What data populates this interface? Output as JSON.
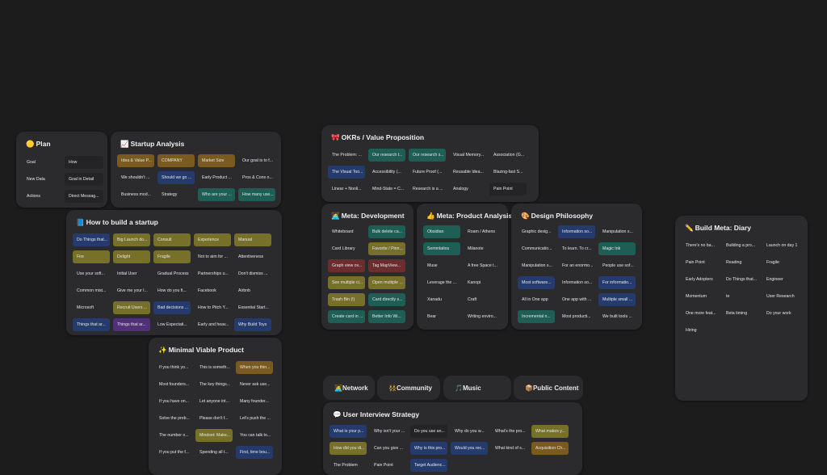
{
  "boards": {
    "plan": {
      "emoji": "🟡",
      "title": "Plan",
      "cards": [
        {
          "text": "Goal",
          "color": "plain"
        },
        {
          "text": "How",
          "color": "dark"
        },
        {
          "text": "New Data",
          "color": "plain"
        },
        {
          "text": "Goal in Detail",
          "color": "dark"
        },
        {
          "text": "Actions",
          "color": "plain"
        },
        {
          "text": "Direct Messag...",
          "color": "dark"
        }
      ]
    },
    "startup_analysis": {
      "emoji": "📈",
      "title": "Startup Analysis",
      "cards": [
        {
          "text": "Idea & Value P...",
          "color": "brown"
        },
        {
          "text": "COMPANY",
          "color": "brown"
        },
        {
          "text": "Market Size",
          "color": "brown"
        },
        {
          "text": "Our goal is to f...",
          "color": "plain"
        },
        {
          "text": "We shouldn't ...",
          "color": "plain"
        },
        {
          "text": "Should we go ...",
          "color": "blue"
        },
        {
          "text": "Early Product ...",
          "color": "plain"
        },
        {
          "text": "Pros & Cons o...",
          "color": "plain"
        },
        {
          "text": "Business mod...",
          "color": "plain"
        },
        {
          "text": "Strategy",
          "color": "plain"
        },
        {
          "text": "Who are your ...",
          "color": "teal"
        },
        {
          "text": "How many use...",
          "color": "teal"
        }
      ]
    },
    "build_startup": {
      "emoji": "📘",
      "title": "How to build a startup",
      "cards": [
        {
          "text": "Do Things that...",
          "color": "blue"
        },
        {
          "text": "Big Launch do...",
          "color": "olive"
        },
        {
          "text": "Consult",
          "color": "olive"
        },
        {
          "text": "Experience",
          "color": "olive"
        },
        {
          "text": "Manual",
          "color": "olive"
        },
        {
          "text": "Fire",
          "color": "olive"
        },
        {
          "text": "Delight",
          "color": "olive"
        },
        {
          "text": "Fragile",
          "color": "olive"
        },
        {
          "text": "Not to aim for ...",
          "color": "plain"
        },
        {
          "text": "Attentiveness",
          "color": "plain"
        },
        {
          "text": "Use your soft...",
          "color": "plain"
        },
        {
          "text": "Initial User",
          "color": "plain"
        },
        {
          "text": "Gradual Process",
          "color": "plain"
        },
        {
          "text": "Partnerships u...",
          "color": "plain"
        },
        {
          "text": "Don't dismiss ...",
          "color": "plain"
        },
        {
          "text": "Common mist...",
          "color": "plain"
        },
        {
          "text": "Give me your l...",
          "color": "plain"
        },
        {
          "text": "How do you fi...",
          "color": "plain"
        },
        {
          "text": "Facebook",
          "color": "plain"
        },
        {
          "text": "Airbnb",
          "color": "plain"
        },
        {
          "text": "Microsoft",
          "color": "plain"
        },
        {
          "text": "Recruit Users ...",
          "color": "olive"
        },
        {
          "text": "Bad decisions ...",
          "color": "blue"
        },
        {
          "text": "How to Pitch Y...",
          "color": "plain"
        },
        {
          "text": "Essential Start...",
          "color": "plain"
        },
        {
          "text": "Things that ar...",
          "color": "blue"
        },
        {
          "text": "Things that ar...",
          "color": "purple"
        },
        {
          "text": "Low Expectati...",
          "color": "plain"
        },
        {
          "text": "Early and heav...",
          "color": "plain"
        },
        {
          "text": "Why Build Toys",
          "color": "blue"
        }
      ]
    },
    "mvp": {
      "emoji": "✨",
      "title": "Minimal Viable Product",
      "cards": [
        {
          "text": "If you think yo...",
          "color": "plain"
        },
        {
          "text": "This is someth...",
          "color": "plain"
        },
        {
          "text": "When you thin...",
          "color": "brown"
        },
        {
          "text": "Most founders...",
          "color": "plain"
        },
        {
          "text": "The key things...",
          "color": "plain"
        },
        {
          "text": "Never ask use...",
          "color": "plain"
        },
        {
          "text": "If you have on...",
          "color": "plain"
        },
        {
          "text": "Let anyone int...",
          "color": "plain"
        },
        {
          "text": "Many founder...",
          "color": "plain"
        },
        {
          "text": "Solve the prob...",
          "color": "plain"
        },
        {
          "text": "Please don't f...",
          "color": "plain"
        },
        {
          "text": "Let's push the ...",
          "color": "plain"
        },
        {
          "text": "The number o...",
          "color": "plain"
        },
        {
          "text": "Mindset: Make...",
          "color": "olive"
        },
        {
          "text": "You can talk to...",
          "color": "plain"
        },
        {
          "text": "If you put the f...",
          "color": "plain"
        },
        {
          "text": "Spending all t...",
          "color": "plain"
        },
        {
          "text": "First, time bou...",
          "color": "blue"
        }
      ]
    },
    "okrs": {
      "emoji": "🎀",
      "title": "OKRs / Value Proposition",
      "cards": [
        {
          "text": "The Problem: ...",
          "color": "plain"
        },
        {
          "text": "Our research t...",
          "color": "teal"
        },
        {
          "text": "Our research s...",
          "color": "teal"
        },
        {
          "text": "Visual Memory...",
          "color": "plain"
        },
        {
          "text": "Association (G...",
          "color": "plain"
        },
        {
          "text": "The Visual Too...",
          "color": "blue"
        },
        {
          "text": "Accessibility (...",
          "color": "plain"
        },
        {
          "text": "Future Proof (...",
          "color": "plain"
        },
        {
          "text": "Reusable Idea...",
          "color": "plain"
        },
        {
          "text": "Blazing-fast S...",
          "color": "plain"
        },
        {
          "text": "Linear + Nonli...",
          "color": "plain"
        },
        {
          "text": "Mind-State = C...",
          "color": "plain"
        },
        {
          "text": "Research is a ...",
          "color": "plain"
        },
        {
          "text": "Analogy",
          "color": "plain"
        },
        {
          "text": "Pain Point",
          "color": "dark"
        }
      ]
    },
    "meta_dev": {
      "emoji": "🧑‍💻",
      "title": "Meta: Development",
      "cards": [
        {
          "text": "Whiteboard",
          "color": "plain"
        },
        {
          "text": "Bulk delete ca...",
          "color": "teal"
        },
        {
          "text": "Card Library",
          "color": "plain"
        },
        {
          "text": "Favorite / Pinn...",
          "color": "olive"
        },
        {
          "text": "Graph view ov...",
          "color": "red"
        },
        {
          "text": "Tag MapView...",
          "color": "red"
        },
        {
          "text": "See multiple ci...",
          "color": "olive"
        },
        {
          "text": "Open multiple ...",
          "color": "olive"
        },
        {
          "text": "Trash Bin (!)",
          "color": "olive"
        },
        {
          "text": "Card directly s...",
          "color": "teal"
        },
        {
          "text": "Create card in ...",
          "color": "teal"
        },
        {
          "text": "Better Info Wi...",
          "color": "teal"
        }
      ]
    },
    "meta_product": {
      "emoji": "👍",
      "title": "Meta: Product Analysis",
      "cards": [
        {
          "text": "Obsidian",
          "color": "teal"
        },
        {
          "text": "Roam / Athens",
          "color": "plain"
        },
        {
          "text": "Semmlatios",
          "color": "teal"
        },
        {
          "text": "Milanote",
          "color": "plain"
        },
        {
          "text": "Muse",
          "color": "plain"
        },
        {
          "text": "A free Space t...",
          "color": "plain"
        },
        {
          "text": "Leverage the ...",
          "color": "plain"
        },
        {
          "text": "Kanopi",
          "color": "plain"
        },
        {
          "text": "Xanadu",
          "color": "plain"
        },
        {
          "text": "Craft",
          "color": "plain"
        },
        {
          "text": "Bear",
          "color": "plain"
        },
        {
          "text": "Writing enviro...",
          "color": "plain"
        }
      ]
    },
    "design": {
      "emoji": "🎨",
      "title": "Design Philosophy",
      "cards": [
        {
          "text": "Graphic desig...",
          "color": "plain"
        },
        {
          "text": "Information so...",
          "color": "blue"
        },
        {
          "text": "Manipulation s...",
          "color": "plain"
        },
        {
          "text": "Communicatio...",
          "color": "plain"
        },
        {
          "text": "To learn. To cr...",
          "color": "plain"
        },
        {
          "text": "Magic Ink",
          "color": "teal"
        },
        {
          "text": "Manipulation s...",
          "color": "plain"
        },
        {
          "text": "For an enormo...",
          "color": "plain"
        },
        {
          "text": "People use sof...",
          "color": "plain"
        },
        {
          "text": "Most software...",
          "color": "blue"
        },
        {
          "text": "Information so...",
          "color": "plain"
        },
        {
          "text": "For informatio...",
          "color": "blue"
        },
        {
          "text": "All in One app",
          "color": "plain"
        },
        {
          "text": "One app with ...",
          "color": "plain"
        },
        {
          "text": "Multiple small ...",
          "color": "blue"
        },
        {
          "text": "Incremental n...",
          "color": "teal"
        },
        {
          "text": "Most producti...",
          "color": "plain"
        },
        {
          "text": "We built tools ...",
          "color": "plain"
        }
      ]
    },
    "diary": {
      "emoji": "✏️",
      "title": "Build Meta: Diary",
      "cards": [
        {
          "text": "There's no ba...",
          "color": "plain"
        },
        {
          "text": "Building a pro...",
          "color": "plain"
        },
        {
          "text": "Launch on day 1",
          "color": "plain"
        },
        {
          "text": "Pain Point",
          "color": "plain"
        },
        {
          "text": "Reading",
          "color": "plain"
        },
        {
          "text": "Fragile",
          "color": "plain"
        },
        {
          "text": "Early Adopters",
          "color": "plain"
        },
        {
          "text": "Do Things that...",
          "color": "plain"
        },
        {
          "text": "Engineer",
          "color": "plain"
        },
        {
          "text": "Momentum",
          "color": "plain"
        },
        {
          "text": "te",
          "color": "plain"
        },
        {
          "text": "User Research",
          "color": "plain"
        },
        {
          "text": "One more feat...",
          "color": "plain"
        },
        {
          "text": "Beta timing",
          "color": "plain"
        },
        {
          "text": "Do your work",
          "color": "plain"
        },
        {
          "text": "Hiring",
          "color": "plain"
        }
      ]
    },
    "interview": {
      "emoji": "💬",
      "title": "User Interview Strategy",
      "cards": [
        {
          "text": "What is your p...",
          "color": "blue"
        },
        {
          "text": "Why isn't your ...",
          "color": "plain"
        },
        {
          "text": "Do you use an...",
          "color": "dark"
        },
        {
          "text": "Why do you w...",
          "color": "plain"
        },
        {
          "text": "What's the pro...",
          "color": "plain"
        },
        {
          "text": "What makes y...",
          "color": "olive"
        },
        {
          "text": "How did you di...",
          "color": "olive"
        },
        {
          "text": "Can you give ...",
          "color": "plain"
        },
        {
          "text": "Why is this pro...",
          "color": "blue"
        },
        {
          "text": "Would you rec...",
          "color": "blue"
        },
        {
          "text": "What kind of s...",
          "color": "plain"
        },
        {
          "text": "Acquisition Ch...",
          "color": "brown"
        },
        {
          "text": "The Problem",
          "color": "plain"
        },
        {
          "text": "Pain Point",
          "color": "plain"
        },
        {
          "text": "Target Audienc...",
          "color": "blue"
        }
      ]
    }
  },
  "tabs": [
    {
      "emoji": "🧑‍💻",
      "label": "Network"
    },
    {
      "emoji": "👯",
      "label": "Community"
    },
    {
      "emoji": "🎵",
      "label": "Music"
    },
    {
      "emoji": "📦",
      "label": "Public Content"
    }
  ],
  "colors": {
    "background": "#1c1c1d",
    "board": "#2b2b2d",
    "olive": "#76702a",
    "brown": "#7a5a1f",
    "blue": "#253b6e",
    "teal": "#1e5e55",
    "purple": "#51307a",
    "red": "#6b2d2d"
  }
}
